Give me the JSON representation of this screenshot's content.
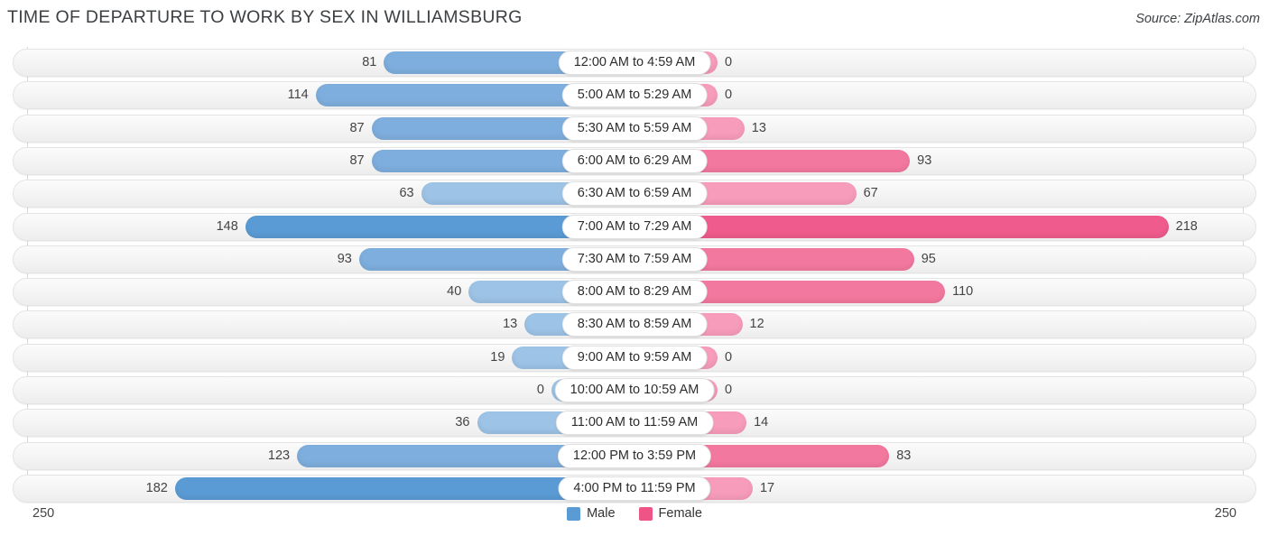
{
  "header": {
    "title": "TIME OF DEPARTURE TO WORK BY SEX IN WILLIAMSBURG",
    "source": "Source: ZipAtlas.com"
  },
  "axis": {
    "left_label": "250",
    "right_label": "250",
    "max": 250
  },
  "legend": {
    "items": [
      {
        "label": "Male",
        "color": "#5b9bd5"
      },
      {
        "label": "Female",
        "color": "#ee5586"
      }
    ]
  },
  "colors": {
    "male_light": "#9dc3e6",
    "male_mid": "#7eaedd",
    "male_dark": "#5b9bd5",
    "female_light": "#f79cbb",
    "female_mid": "#f3789f",
    "female_dark": "#ef5b8c",
    "track": "#f3f3f3",
    "text": "#444444"
  },
  "chart_data": {
    "type": "bar",
    "orientation": "horizontal-diverging",
    "title": "TIME OF DEPARTURE TO WORK BY SEX IN WILLIAMSBURG",
    "xlabel": "",
    "ylabel": "",
    "xlim": [
      250,
      250
    ],
    "grid": false,
    "legend_position": "bottom-center",
    "categories": [
      "12:00 AM to 4:59 AM",
      "5:00 AM to 5:29 AM",
      "5:30 AM to 5:59 AM",
      "6:00 AM to 6:29 AM",
      "6:30 AM to 6:59 AM",
      "7:00 AM to 7:29 AM",
      "7:30 AM to 7:59 AM",
      "8:00 AM to 8:29 AM",
      "8:30 AM to 8:59 AM",
      "9:00 AM to 9:59 AM",
      "10:00 AM to 10:59 AM",
      "11:00 AM to 11:59 AM",
      "12:00 PM to 3:59 PM",
      "4:00 PM to 11:59 PM"
    ],
    "series": [
      {
        "name": "Male",
        "color": "#5b9bd5",
        "values": [
          81,
          114,
          87,
          87,
          63,
          148,
          93,
          40,
          13,
          19,
          0,
          36,
          123,
          182
        ]
      },
      {
        "name": "Female",
        "color": "#ee5586",
        "values": [
          0,
          0,
          13,
          93,
          67,
          218,
          95,
          110,
          12,
          0,
          0,
          14,
          83,
          17
        ]
      }
    ]
  }
}
